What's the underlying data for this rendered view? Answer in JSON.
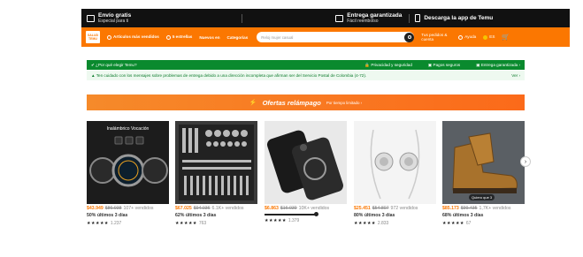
{
  "promo": {
    "shipping_title": "Envío gratis",
    "shipping_sub": "Especial para ti",
    "delivery_title": "Entrega garantizada",
    "delivery_sub": "Fácil reembolso",
    "app": "Descarga la app de Temu"
  },
  "nav": {
    "logo": "SALUD TEMU",
    "links": [
      "Artículos más vendidos",
      "5 estrellas",
      "Nuevos en",
      "Categorías"
    ],
    "search_placeholder": "Reloj mujer casual",
    "orders": "Tus pedidos & cuenta",
    "help": "Ayuda",
    "lang": "ES"
  },
  "why": {
    "label": "¿Por qué elegir Temu?",
    "items": [
      "Privacidad y seguridad",
      "Pagos seguros",
      "Entrega garantizada"
    ]
  },
  "notice": {
    "text": "Ten cuidado con los mensajes sobre problemas de entrega debido a una dirección incompleta que afirman ser del Servicio Postal de Colombia (4-72).",
    "link": "Ver"
  },
  "banner": {
    "title": "Ofertas relámpago",
    "sub": "Por tiempo limitado"
  },
  "products": [
    {
      "price": "$43.949",
      "orig": "$86.938",
      "sold": "107+ vendidos",
      "sub": "50% últimos 3 días",
      "reviews": "1.237",
      "img_text": "Inalámbrico Vocación"
    },
    {
      "price": "$67.025",
      "orig": "$94.036",
      "sold": "6.1K+ vendidos",
      "sub": "62% últimos 3 días",
      "reviews": "763"
    },
    {
      "price": "$6.863",
      "orig": "$16.039",
      "sold": "10K+ vendidos",
      "sub": "",
      "reviews": "1.379"
    },
    {
      "price": "$25.451",
      "orig": "$54.807",
      "sold": "972 vendidos",
      "sub": "80% últimos 3 días",
      "reviews": "2.833"
    },
    {
      "price": "$85.173",
      "orig": "$99.435",
      "sold": "1,7K+ vendidos",
      "sub": "68% últimos 3 días",
      "reviews": "67",
      "tag": "Quiero que 3"
    }
  ],
  "colors": {
    "orange": "#fb7701",
    "green": "#0a8a2e",
    "black": "#111111"
  }
}
